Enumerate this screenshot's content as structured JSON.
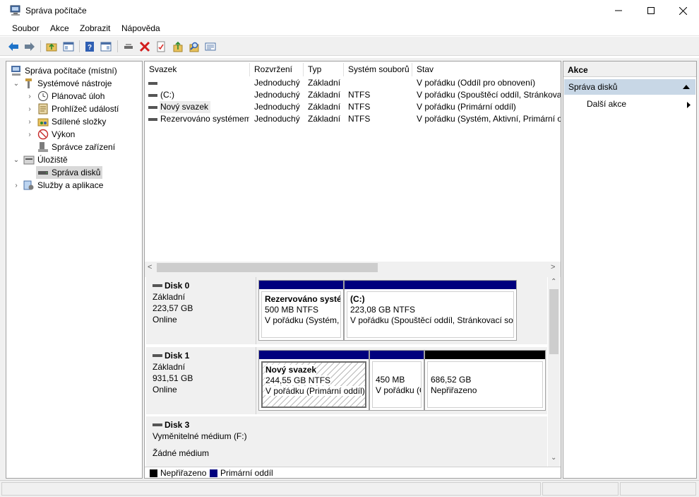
{
  "window": {
    "title": "Správa počítače"
  },
  "menu": [
    "Soubor",
    "Akce",
    "Zobrazit",
    "Nápověda"
  ],
  "toolbar": [
    "back-icon",
    "forward-icon",
    "up-folder-icon",
    "show-hide-tree-icon",
    "help-icon",
    "show-hide-action-pane-icon",
    "connect-icon",
    "delete-icon",
    "properties-icon",
    "import-icon",
    "find-icon",
    "settings-icon"
  ],
  "tree": {
    "root": "Správa počítače (místní)",
    "system_tools": "Systémové nástroje",
    "scheduler": "Plánovač úloh",
    "event_viewer": "Prohlížeč událostí",
    "shared": "Sdílené složky",
    "performance": "Výkon",
    "device_manager": "Správce zařízení",
    "storage": "Úložiště",
    "disk_mgmt": "Správa disků",
    "services": "Služby a aplikace"
  },
  "volumes": {
    "headers": [
      "Svazek",
      "Rozvržení",
      "Typ",
      "Systém souborů",
      "Stav"
    ],
    "rows": [
      [
        "",
        "Jednoduchý",
        "Základní",
        "",
        "V pořádku (Oddíl pro obnovení)"
      ],
      [
        "(C:)",
        "Jednoduchý",
        "Základní",
        "NTFS",
        "V pořádku (Spouštěcí oddíl, Stránkovací soubor)"
      ],
      [
        "Nový svazek",
        "Jednoduchý",
        "Základní",
        "NTFS",
        "V pořádku (Primární oddíl)"
      ],
      [
        "Rezervováno systémem",
        "Jednoduchý",
        "Základní",
        "NTFS",
        "V pořádku (Systém, Aktivní, Primární oddíl)"
      ]
    ]
  },
  "disks": {
    "d0": {
      "name": "Disk 0",
      "type": "Základní",
      "size": "223,57 GB",
      "status": "Online"
    },
    "d0p1": {
      "name": "Rezervováno systémem",
      "size": "500 MB NTFS",
      "status": "V pořádku (Systém, Aktivní, Primární oddíl)"
    },
    "d0p2": {
      "name": "(C:)",
      "size": "223,08 GB NTFS",
      "status": "V pořádku (Spouštěcí oddíl, Stránkovací soubor)"
    },
    "d1": {
      "name": "Disk 1",
      "type": "Základní",
      "size": "931,51 GB",
      "status": "Online"
    },
    "d1p1": {
      "name": "Nový svazek",
      "size": "244,55 GB NTFS",
      "status": "V pořádku (Primární oddíl)"
    },
    "d1p2": {
      "size": "450 MB",
      "status": "V pořádku (Oddíl pro obnovení)"
    },
    "d1p3": {
      "size": "686,52 GB",
      "status": "Nepřiřazeno"
    },
    "d3": {
      "name": "Disk 3",
      "type": "Vyměnitelné médium (F:)",
      "status": "Žádné médium"
    }
  },
  "legend": {
    "unallocated": "Nepřiřazeno",
    "primary": "Primární oddíl"
  },
  "actions": {
    "title": "Akce",
    "section": "Správa disků",
    "more": "Další akce"
  },
  "colors": {
    "primary": "#00007e",
    "unallocated": "#000000",
    "selection": "#cce8ff",
    "actions_header": "#c8d7e6"
  }
}
